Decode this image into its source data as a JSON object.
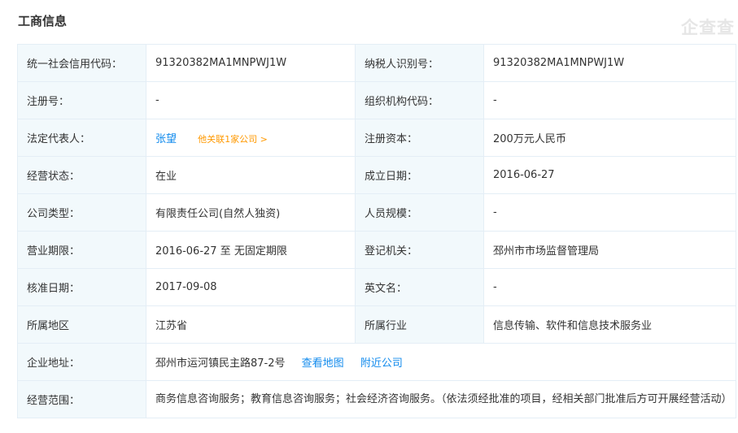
{
  "header": {
    "title": "工商信息",
    "watermark": "企查查"
  },
  "info": {
    "credit_code": {
      "label": "统一社会信用代码：",
      "value": "91320382MA1MNPWJ1W"
    },
    "taxpayer_id": {
      "label": "纳税人识别号：",
      "value": "91320382MA1MNPWJ1W"
    },
    "reg_no": {
      "label": "注册号：",
      "value": "-"
    },
    "org_code": {
      "label": "组织机构代码：",
      "value": "-"
    },
    "legal_rep": {
      "label": "法定代表人：",
      "value": "张望",
      "related": "他关联1家公司 >"
    },
    "reg_capital": {
      "label": "注册资本：",
      "value": "200万元人民币"
    },
    "status": {
      "label": "经营状态：",
      "value": "在业"
    },
    "founded": {
      "label": "成立日期：",
      "value": "2016-06-27"
    },
    "company_type": {
      "label": "公司类型：",
      "value": "有限责任公司(自然人独资)"
    },
    "staff_size": {
      "label": "人员规模：",
      "value": "-"
    },
    "term": {
      "label": "营业期限：",
      "value": "2016-06-27 至 无固定期限"
    },
    "authority": {
      "label": "登记机关：",
      "value": "邳州市市场监督管理局"
    },
    "approval_date": {
      "label": "核准日期：",
      "value": "2017-09-08"
    },
    "english_name": {
      "label": "英文名：",
      "value": "-"
    },
    "region": {
      "label": "所属地区",
      "value": "江苏省"
    },
    "industry": {
      "label": "所属行业",
      "value": "信息传输、软件和信息技术服务业"
    },
    "address": {
      "label": "企业地址：",
      "value": "邳州市运河镇民主路87-2号",
      "view_map": "查看地图",
      "nearby": "附近公司"
    },
    "scope": {
      "label": "经营范围：",
      "value": "商务信息咨询服务；教育信息咨询服务；社会经济咨询服务。（依法须经批准的项目，经相关部门批准后方可开展经营活动）"
    }
  }
}
